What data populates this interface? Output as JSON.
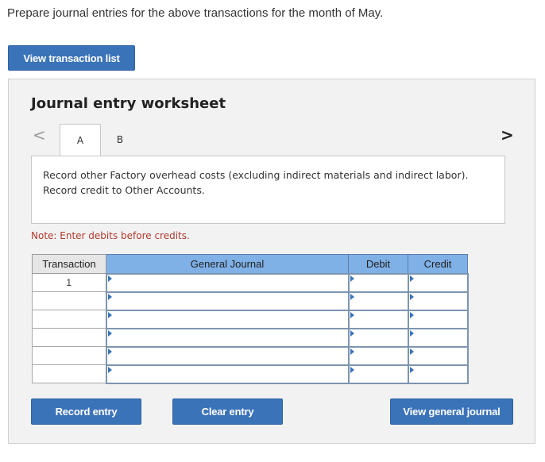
{
  "instruction": "Prepare journal entries for the above transactions for the month of May.",
  "view_list_button": "View transaction list",
  "worksheet": {
    "title": "Journal entry worksheet",
    "nav_prev_glyph": "<",
    "nav_next_glyph": ">",
    "tabs": [
      {
        "label": "A",
        "active": true
      },
      {
        "label": "B",
        "active": false
      }
    ],
    "description": "Record other Factory overhead costs (excluding indirect materials and indirect labor). Record credit to Other Accounts.",
    "note": "Note: Enter debits before credits.",
    "table": {
      "headers": [
        "Transaction",
        "General Journal",
        "Debit",
        "Credit"
      ],
      "rows": [
        {
          "transaction": "1"
        },
        {
          "transaction": ""
        },
        {
          "transaction": ""
        },
        {
          "transaction": ""
        },
        {
          "transaction": ""
        },
        {
          "transaction": ""
        }
      ]
    },
    "buttons": {
      "record": "Record entry",
      "clear": "Clear entry",
      "view_general_journal": "View general journal"
    }
  },
  "colors": {
    "button_blue": "#3b73b9",
    "header_blue": "#7fb0e6",
    "note_red": "#b03a2e"
  }
}
